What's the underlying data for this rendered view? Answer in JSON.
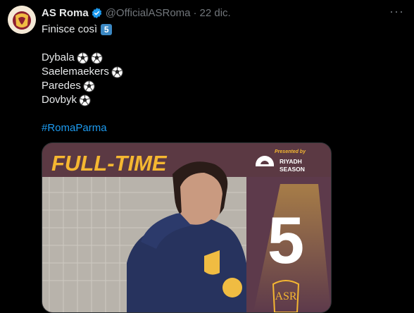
{
  "tweet": {
    "author_name": "AS Roma",
    "handle": "@OfficialASRoma",
    "separator": "·",
    "date": "22 dic.",
    "more_label": "···",
    "intro_text": "Finisce così",
    "score_emoji": "5",
    "scorers": [
      {
        "name": "Dybala",
        "goals": 2
      },
      {
        "name": "Saelemaekers",
        "goals": 1
      },
      {
        "name": "Paredes",
        "goals": 1
      },
      {
        "name": "Dovbyk",
        "goals": 1
      }
    ],
    "hashtag": "#RomaParma"
  },
  "media": {
    "banner": "FULL-TIME",
    "presented_by": "Presented by",
    "sponsor_line1": "RIYADH",
    "sponsor_line2": "SEASON",
    "score": "5",
    "crest_letters": "ASR"
  },
  "colors": {
    "background": "#000000",
    "text": "#e7e9ea",
    "muted": "#71767b",
    "link": "#1d9bf0",
    "banner_yellow": "#f5b731",
    "verified": "#1d9bf0"
  }
}
